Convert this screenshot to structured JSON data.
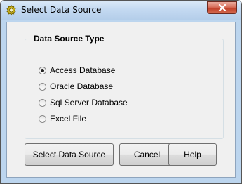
{
  "window": {
    "title": "Select Data Source"
  },
  "group": {
    "label": "Data Source Type",
    "options": [
      {
        "label": "Access Database",
        "checked": true
      },
      {
        "label": "Oracle Database",
        "checked": false
      },
      {
        "label": "Sql Server Database",
        "checked": false
      },
      {
        "label": "Excel File",
        "checked": false
      }
    ]
  },
  "buttons": {
    "select": "Select Data Source",
    "cancel": "Cancel",
    "help": "Help"
  },
  "icons": {
    "app": "gear-icon",
    "close": "close-icon"
  }
}
